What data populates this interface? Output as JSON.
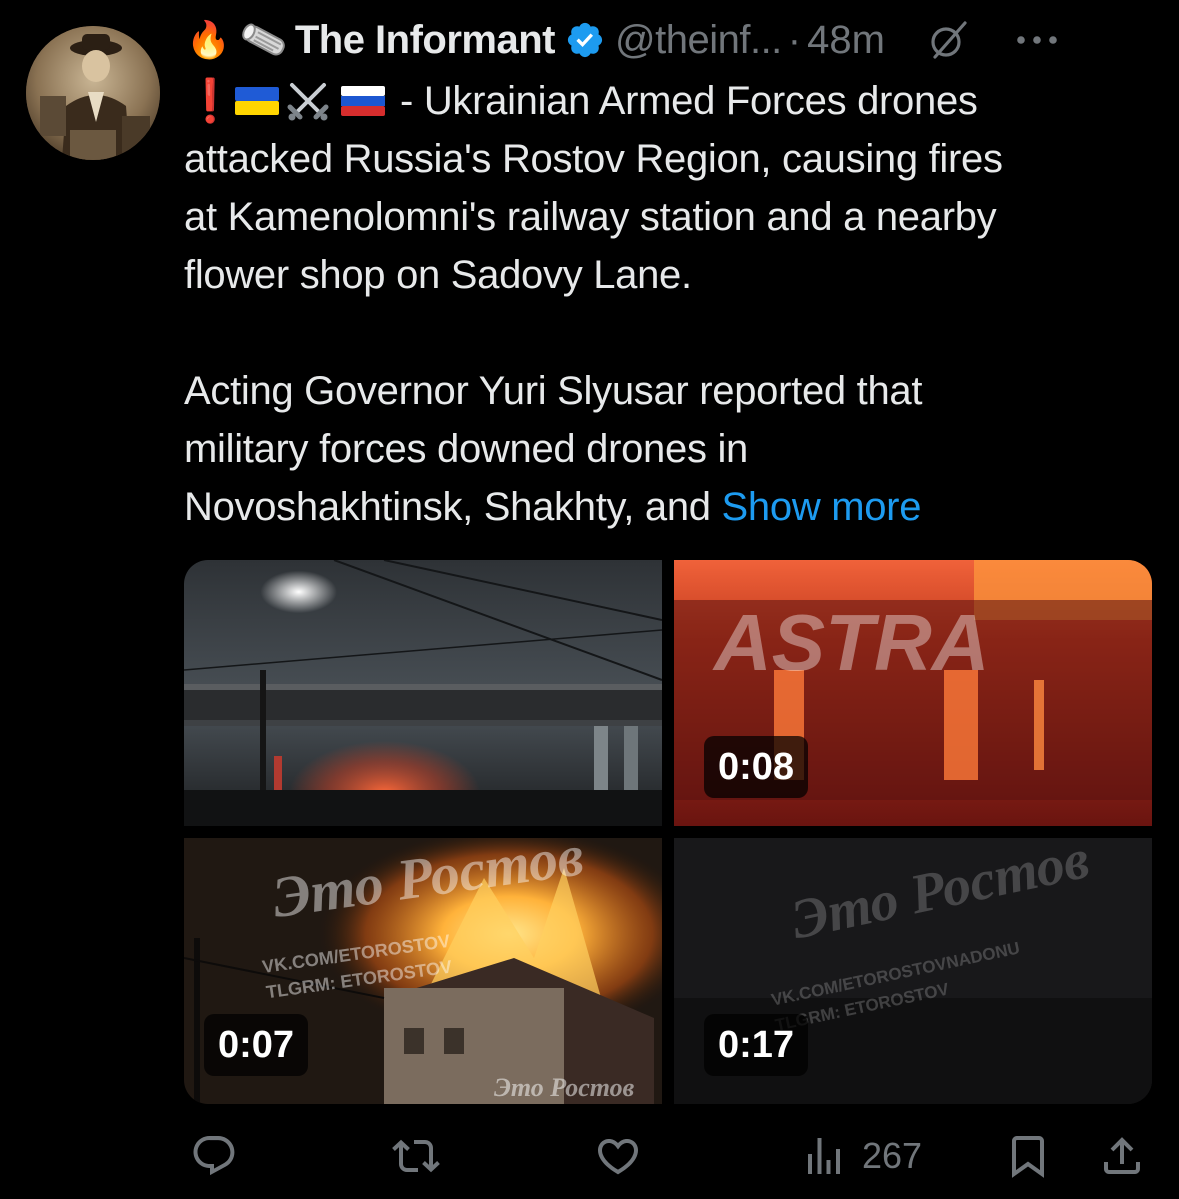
{
  "tweet": {
    "author_name": "The Informant",
    "handle": "@theinf...",
    "separator": "·",
    "time": "48m",
    "line1_text": "- Ukrainian Armed Forces drones",
    "line2_text": "attacked Russia's Rostov Region, causing fires",
    "line3_text": "at Kamenolomni's railway station and a nearby",
    "line4_text": "flower shop on Sadovy Lane.",
    "p2_line1": "Acting Governor Yuri Slyusar reported that",
    "p2_line2": "military forces downed drones in",
    "p2_line3": "Novoshakhtinsk, Shakhty, and",
    "show_more": "Show more",
    "emoji_fire": "🔥",
    "emoji_exclaim": "❗"
  },
  "media": {
    "tile2_duration": "0:08",
    "tile3_duration": "0:07",
    "tile4_duration": "0:17",
    "tile2_watermark": "ASTRA",
    "tile3_watermark_top": "Это Ростов",
    "tile3_watermark_mid": "VK.COM/ETOROSTOV",
    "tile3_watermark_mid2": "TLGRM: ETOROSTOV",
    "tile3_watermark_bottom": "Это Ростов",
    "tile4_watermark_top": "Это Ростов",
    "tile4_watermark_mid": "VK.COM/ETOROSTOVNADONU",
    "tile4_watermark_mid2": "TLGRM: ETOROSTOV"
  },
  "actions": {
    "views": "267",
    "icons": [
      "reply-icon",
      "retweet-icon",
      "like-icon",
      "views-icon",
      "bookmark-icon",
      "share-icon"
    ]
  },
  "colors": {
    "accent": "#1d9bf0",
    "text": "#e7e9ea",
    "muted": "#71767b",
    "background": "#000000"
  }
}
